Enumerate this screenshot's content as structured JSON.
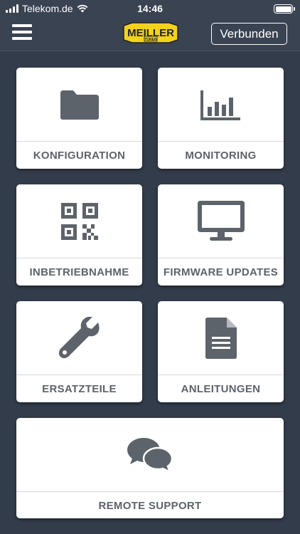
{
  "status_bar": {
    "carrier": "Telekom.de",
    "time": "14:46"
  },
  "header": {
    "logo_text": "MEILLER",
    "logo_subtext": "TÜREN",
    "connect_label": "Verbunden"
  },
  "tiles": [
    {
      "label": "KONFIGURATION",
      "icon": "folder-icon"
    },
    {
      "label": "MONITORING",
      "icon": "bar-chart-icon"
    },
    {
      "label": "INBETRIEBNAHME",
      "icon": "qr-code-icon"
    },
    {
      "label": "FIRMWARE UPDATES",
      "icon": "monitor-icon"
    },
    {
      "label": "ERSATZTEILE",
      "icon": "wrench-icon"
    },
    {
      "label": "ANLEITUNGEN",
      "icon": "document-icon"
    },
    {
      "label": "REMOTE SUPPORT",
      "icon": "chat-bubbles-icon"
    }
  ],
  "colors": {
    "background": "#333c4b",
    "tile": "#ffffff",
    "icon": "#5d636b",
    "logo_yellow": "#f3d21b"
  }
}
